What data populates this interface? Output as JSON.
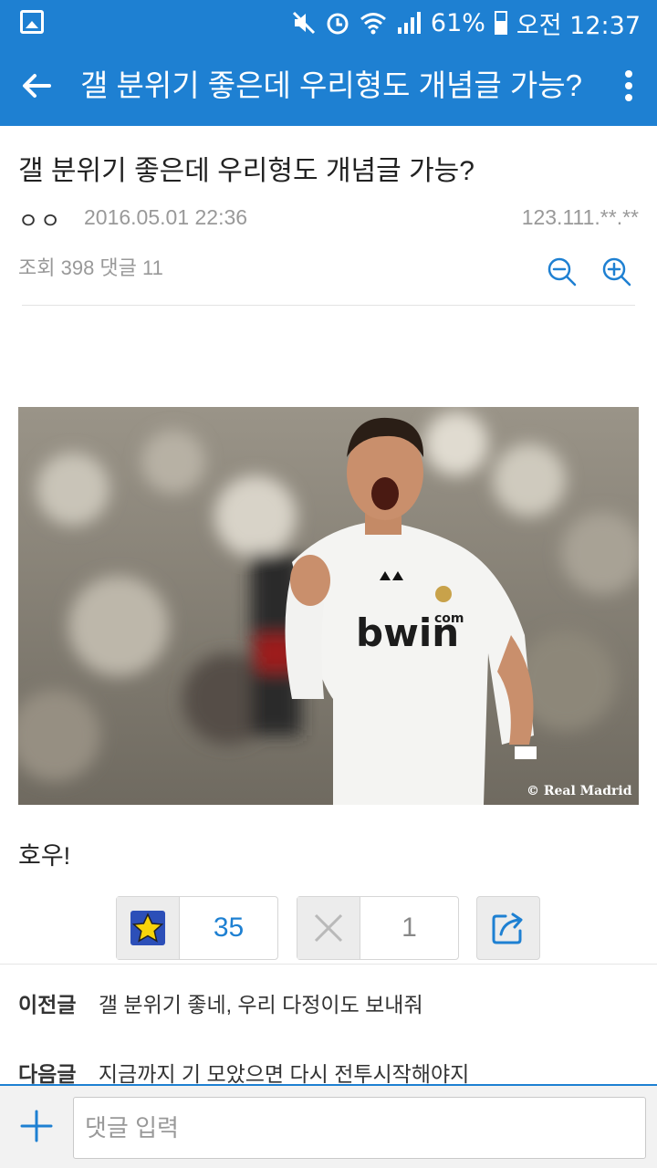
{
  "status_bar": {
    "battery": "61%",
    "time": "오전 12:37",
    "icons": [
      "gallery-icon",
      "mute-icon",
      "alarm-icon",
      "wifi-icon",
      "signal-icon",
      "battery-icon"
    ]
  },
  "app_bar": {
    "title": "갤 분위기 좋은데 우리형도 개념글 가능?"
  },
  "post": {
    "title": "갤 분위기 좋은데 우리형도 개념글 가능?",
    "author": "ㅇㅇ",
    "date": "2016.05.01 22:36",
    "ip": "123.111.**.**",
    "stats": "조회 398 댓글 11",
    "image_caption": "© Real Madrid",
    "shirt_text": "bwin",
    "shirt_sub": "com",
    "body": "호우!"
  },
  "votes": {
    "up_count": "35",
    "down_count": "1"
  },
  "navigation": {
    "prev_label": "이전글",
    "prev_title": "갤 분위기 좋네, 우리 다정이도 보내줘",
    "next_label": "다음글",
    "next_title": "지금까지 기 모았으면 다시 전투시작해야지"
  },
  "comment_bar": {
    "placeholder": "댓글 입력"
  },
  "colors": {
    "primary": "#1e80d2",
    "star": "#f7d40a"
  }
}
